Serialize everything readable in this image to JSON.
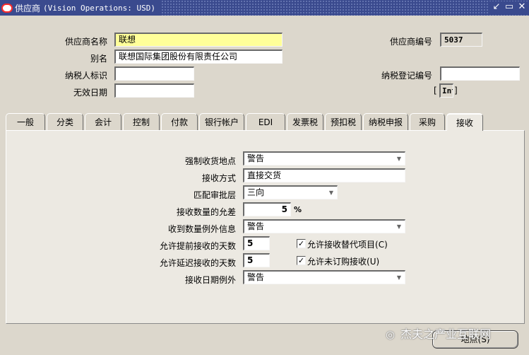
{
  "window": {
    "title": "供应商",
    "app": "(Vision Operations: USD)"
  },
  "header": {
    "supplier_name_label": "供应商名称",
    "supplier_name_value": "联想",
    "alias_label": "别名",
    "alias_value": "联想国际集团股份有限责任公司",
    "taxpayer_id_label": "纳税人标识",
    "taxpayer_id_value": "",
    "inactive_date_label": "无效日期",
    "inactive_date_value": "",
    "supplier_number_label": "供应商编号",
    "supplier_number_value": "5037",
    "tax_reg_label": "纳税登记编号",
    "tax_reg_value": "",
    "bracket_left": "[",
    "bracket_value": "Int",
    "bracket_right": "]"
  },
  "tabs": [
    {
      "label": "一般"
    },
    {
      "label": "分类"
    },
    {
      "label": "会计"
    },
    {
      "label": "控制"
    },
    {
      "label": "付款"
    },
    {
      "label": "银行帐户"
    },
    {
      "label": "EDI"
    },
    {
      "label": "发票税"
    },
    {
      "label": "预扣税"
    },
    {
      "label": "纳税申报"
    },
    {
      "label": "采购"
    },
    {
      "label": "接收",
      "active": true
    }
  ],
  "receiving": {
    "enforce_ship_to_label": "强制收货地点",
    "enforce_ship_to_value": "警告",
    "receipt_routing_label": "接收方式",
    "receipt_routing_value": "直接交货",
    "match_approval_label": "匹配审批层",
    "match_approval_value": "三向",
    "qty_tolerance_label": "接收数量的允差",
    "qty_tolerance_value": "5",
    "qty_tolerance_unit": "%",
    "over_receipt_label": "收到数量例外信息",
    "over_receipt_value": "警告",
    "days_early_label": "允许提前接收的天数",
    "days_early_value": "5",
    "days_late_label": "允许延迟接收的天数",
    "days_late_value": "5",
    "date_exception_label": "接收日期例外",
    "date_exception_value": "警告",
    "allow_substitute_label": "允许接收替代项目",
    "allow_substitute_key": "(C)",
    "allow_substitute_checked": true,
    "allow_unordered_label": "允许未订购接收",
    "allow_unordered_key": "(U)",
    "allow_unordered_checked": true
  },
  "buttons": {
    "sites_label": "地点",
    "sites_key": "(S)"
  },
  "watermark": "杰夫之产业互联网"
}
